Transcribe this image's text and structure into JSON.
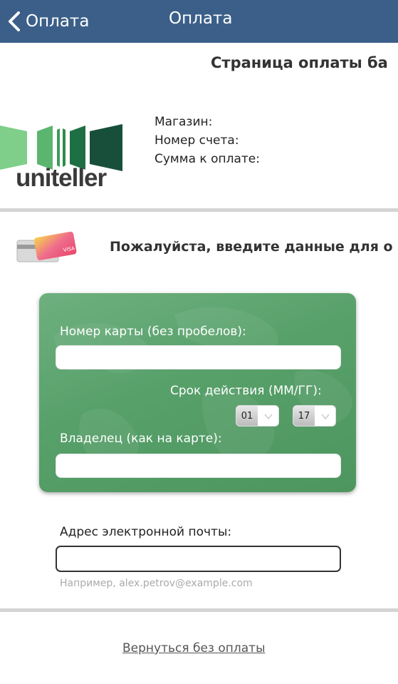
{
  "header": {
    "back_label": "Оплата",
    "title": "Оплата",
    "color": "#3b5f88"
  },
  "page": {
    "heading": "Страница оплаты ба"
  },
  "merchant": {
    "logo_text": "uniteller",
    "labels": [
      "Магазин:",
      "Номер счета:",
      "Сумма к оплате:"
    ]
  },
  "card_section": {
    "icon": "credit-cards-icon",
    "prompt": "Пожалуйста, введите данные для о",
    "card_number_label": "Номер карты (без пробелов):",
    "card_number_value": "",
    "expiry_label": "Срок действия (ММ/ГГ):",
    "expiry_month": "01",
    "expiry_year": "17",
    "holder_label": "Владелец (как на карте):",
    "holder_value": "",
    "panel_color": "#5aa36d"
  },
  "email": {
    "label": "Адрес электронной почты:",
    "value": "",
    "hint": "Например, alex.petrov@example.com"
  },
  "footer": {
    "return_link": "Вернуться без оплаты"
  }
}
